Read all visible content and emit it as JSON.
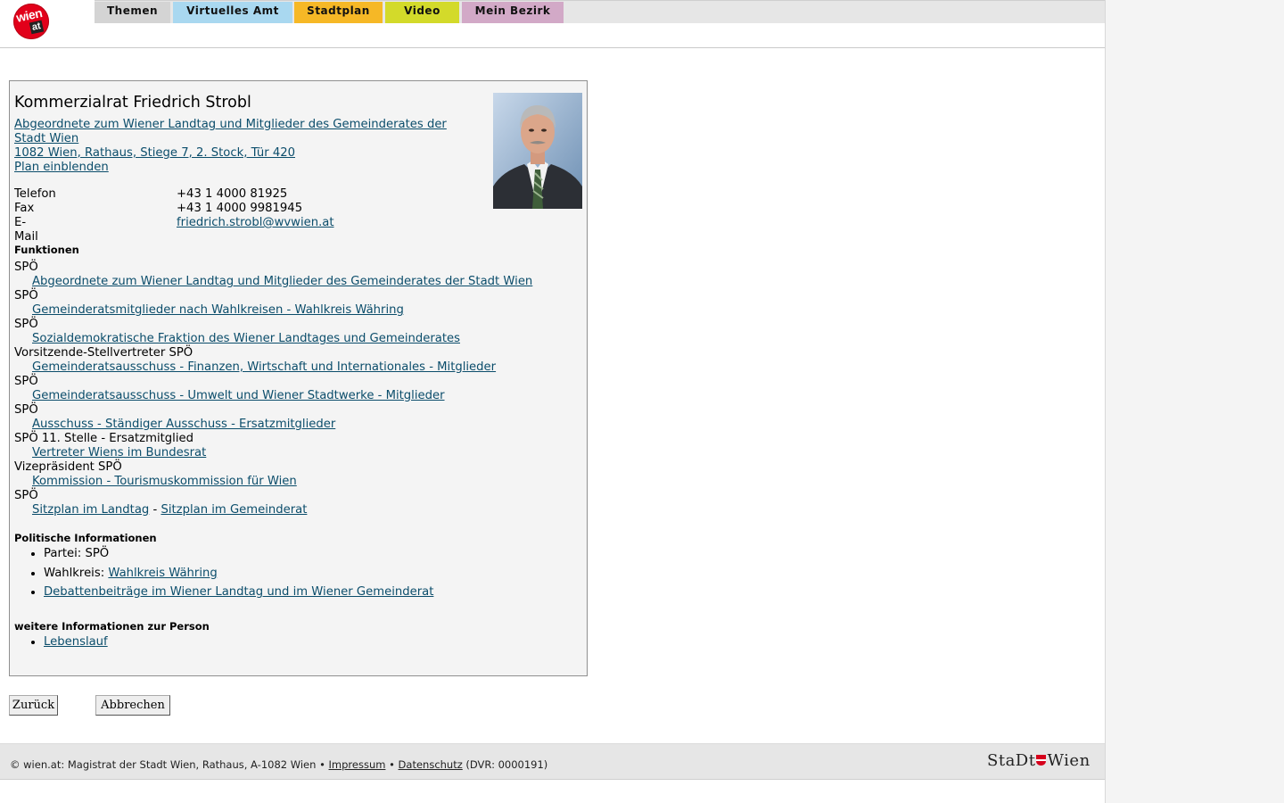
{
  "header": {
    "logo_text": "wien",
    "logo_sub": "at",
    "tabs": [
      "Themen",
      "Virtuelles Amt",
      "Stadtplan",
      "Video",
      "Mein Bezirk"
    ]
  },
  "person": {
    "name": "Kommerzialrat Friedrich Strobl",
    "org_link": "Abgeordnete zum Wiener Landtag und Mitglieder des Gemeinderates der Stadt Wien",
    "address": "1082 Wien, Rathaus, Stiege 7, 2. Stock, Tür 420",
    "plan_link": "Plan einblenden",
    "contacts": [
      {
        "label": "Telefon",
        "value": "+43 1 4000 81925"
      },
      {
        "label": "Fax",
        "value": "+43 1 4000 9981945"
      },
      {
        "label": "E-Mail",
        "value": "friedrich.strobl@wvwien.at"
      }
    ]
  },
  "funktionen": {
    "heading": "Funktionen",
    "items": [
      {
        "role": "SPÖ",
        "link": "Abgeordnete zum Wiener Landtag und Mitglieder des Gemeinderates der Stadt Wien"
      },
      {
        "role": "SPÖ",
        "link": "Gemeinderatsmitglieder nach Wahlkreisen - Wahlkreis Währing"
      },
      {
        "role": "SPÖ",
        "link": "Sozialdemokratische Fraktion des Wiener Landtages und Gemeinderates"
      },
      {
        "role": "Vorsitzende-Stellvertreter SPÖ",
        "link": "Gemeinderatsausschuss - Finanzen, Wirtschaft und Internationales - Mitglieder"
      },
      {
        "role": "SPÖ",
        "link": "Gemeinderatsausschuss - Umwelt und Wiener Stadtwerke - Mitglieder"
      },
      {
        "role": "SPÖ",
        "link": "Ausschuss - Ständiger Ausschuss - Ersatzmitglieder"
      },
      {
        "role": "SPÖ 11. Stelle - Ersatzmitglied",
        "link": "Vertreter Wiens im Bundesrat"
      },
      {
        "role": "Vizepräsident SPÖ",
        "link": "Kommission - Tourismuskommission für Wien"
      }
    ],
    "last_role": "SPÖ",
    "sitzplan_landtag": "Sitzplan im Landtag",
    "separator": "-",
    "sitzplan_gemeinderat": "Sitzplan im Gemeinderat"
  },
  "politische": {
    "heading": "Politische Informationen",
    "partei": "Partei: SPÖ",
    "wahlkreis_label": "Wahlkreis:",
    "wahlkreis_link": "Wahlkreis Währing",
    "debatten_link": "Debattenbeiträge im Wiener Landtag und im Wiener Gemeinderat"
  },
  "weitere": {
    "heading": "weitere Informationen zur Person",
    "lebenslauf": "Lebenslauf"
  },
  "buttons": {
    "back": "Zurück",
    "cancel": "Abbrechen"
  },
  "footer": {
    "text_start": "© wien.at: Magistrat der Stadt Wien, Rathaus, A-1082 Wien •",
    "impressum": "Impressum",
    "bullet": "•",
    "datenschutz": "Datenschutz",
    "text_end": "(DVR: 0000191)",
    "brand_left": "StaDt",
    "brand_right": "Wien"
  }
}
